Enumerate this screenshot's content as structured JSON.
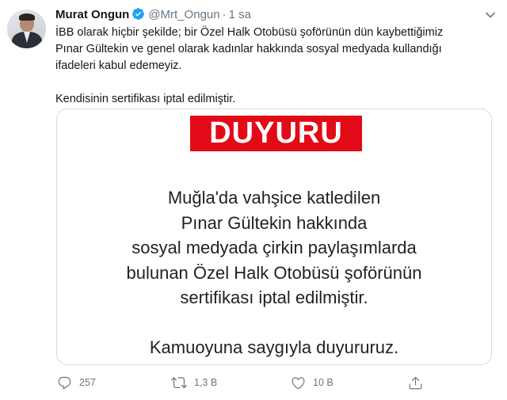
{
  "tweet": {
    "author_name": "Murat Ongun",
    "handle": "@Mrt_Ongun",
    "separator": "·",
    "time": "1 sa",
    "text_lines": [
      "İBB olarak hiçbir şekilde; bir Özel Halk Otobüsü şoförünün dün kaybettiğimiz",
      "Pınar Gültekin ve genel olarak kadınlar hakkında sosyal medyada kullandığı",
      "ifadeleri kabul edemeyiz."
    ],
    "text_followup": "Kendisinin sertifikası iptal edilmiştir.",
    "image": {
      "banner": "DUYURU",
      "announcement_lines": [
        "Muğla'da vahşice katledilen",
        "Pınar Gültekin hakkında",
        "sosyal medyada çirkin paylaşımlarda",
        "bulunan Özel Halk Otobüsü şoförünün",
        "sertifikası iptal edilmiştir."
      ],
      "closing": "Kamuoyuna saygıyla duyururuz.",
      "banner_color": "#e30a17"
    },
    "actions": {
      "reply_count": "257",
      "retweet_count": "1,3 B",
      "like_count": "10 B"
    },
    "icons": {
      "verified": "verified-badge-icon",
      "more": "chevron-down-icon",
      "reply": "reply-icon",
      "retweet": "retweet-icon",
      "like": "heart-icon",
      "share": "share-icon"
    },
    "colors": {
      "verified_blue": "#1da1f2",
      "meta_gray": "#657786"
    }
  }
}
